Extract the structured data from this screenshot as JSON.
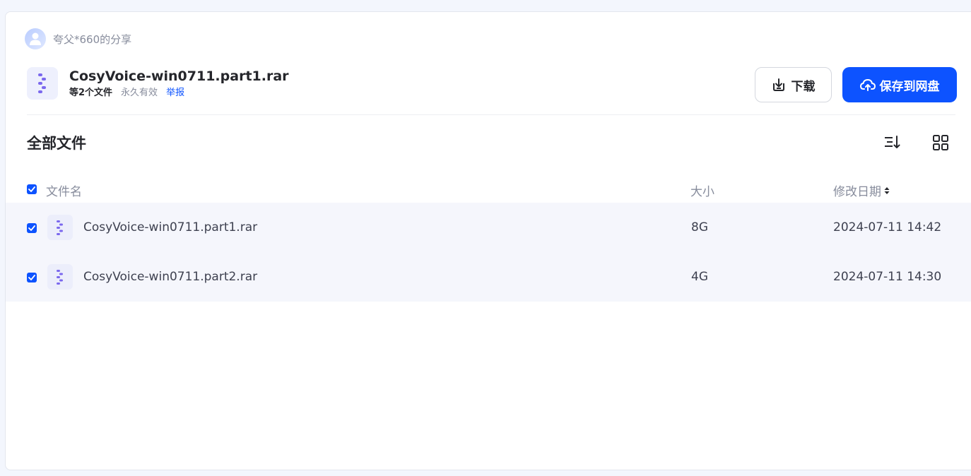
{
  "sharer": {
    "name": "夸父*660的分享"
  },
  "header": {
    "title": "CosyVoice-win0711.part1.rar",
    "file_count": "等2个文件",
    "validity": "永久有效",
    "report": "举报",
    "download_label": "下载",
    "save_label": "保存到网盘"
  },
  "section": {
    "title": "全部文件"
  },
  "table": {
    "columns": {
      "name": "文件名",
      "size": "大小",
      "date": "修改日期"
    },
    "rows": [
      {
        "name": "CosyVoice-win0711.part1.rar",
        "size": "8G",
        "date": "2024-07-11 14:42",
        "checked": true
      },
      {
        "name": "CosyVoice-win0711.part2.rar",
        "size": "4G",
        "date": "2024-07-11 14:30",
        "checked": true
      }
    ]
  },
  "colors": {
    "accent": "#0d53ff",
    "page_bg": "#f3f6fd",
    "row_bg": "#f5f6fc",
    "icon_purple": "#7b68ee"
  },
  "icons": {
    "avatar": "user-avatar-icon",
    "file": "archive-zip-icon",
    "download": "download-icon",
    "save": "cloud-upload-icon",
    "sort": "sort-list-icon",
    "grid": "grid-view-icon",
    "sort_arrows": "sort-caret-icon",
    "check": "checkmark-icon"
  }
}
